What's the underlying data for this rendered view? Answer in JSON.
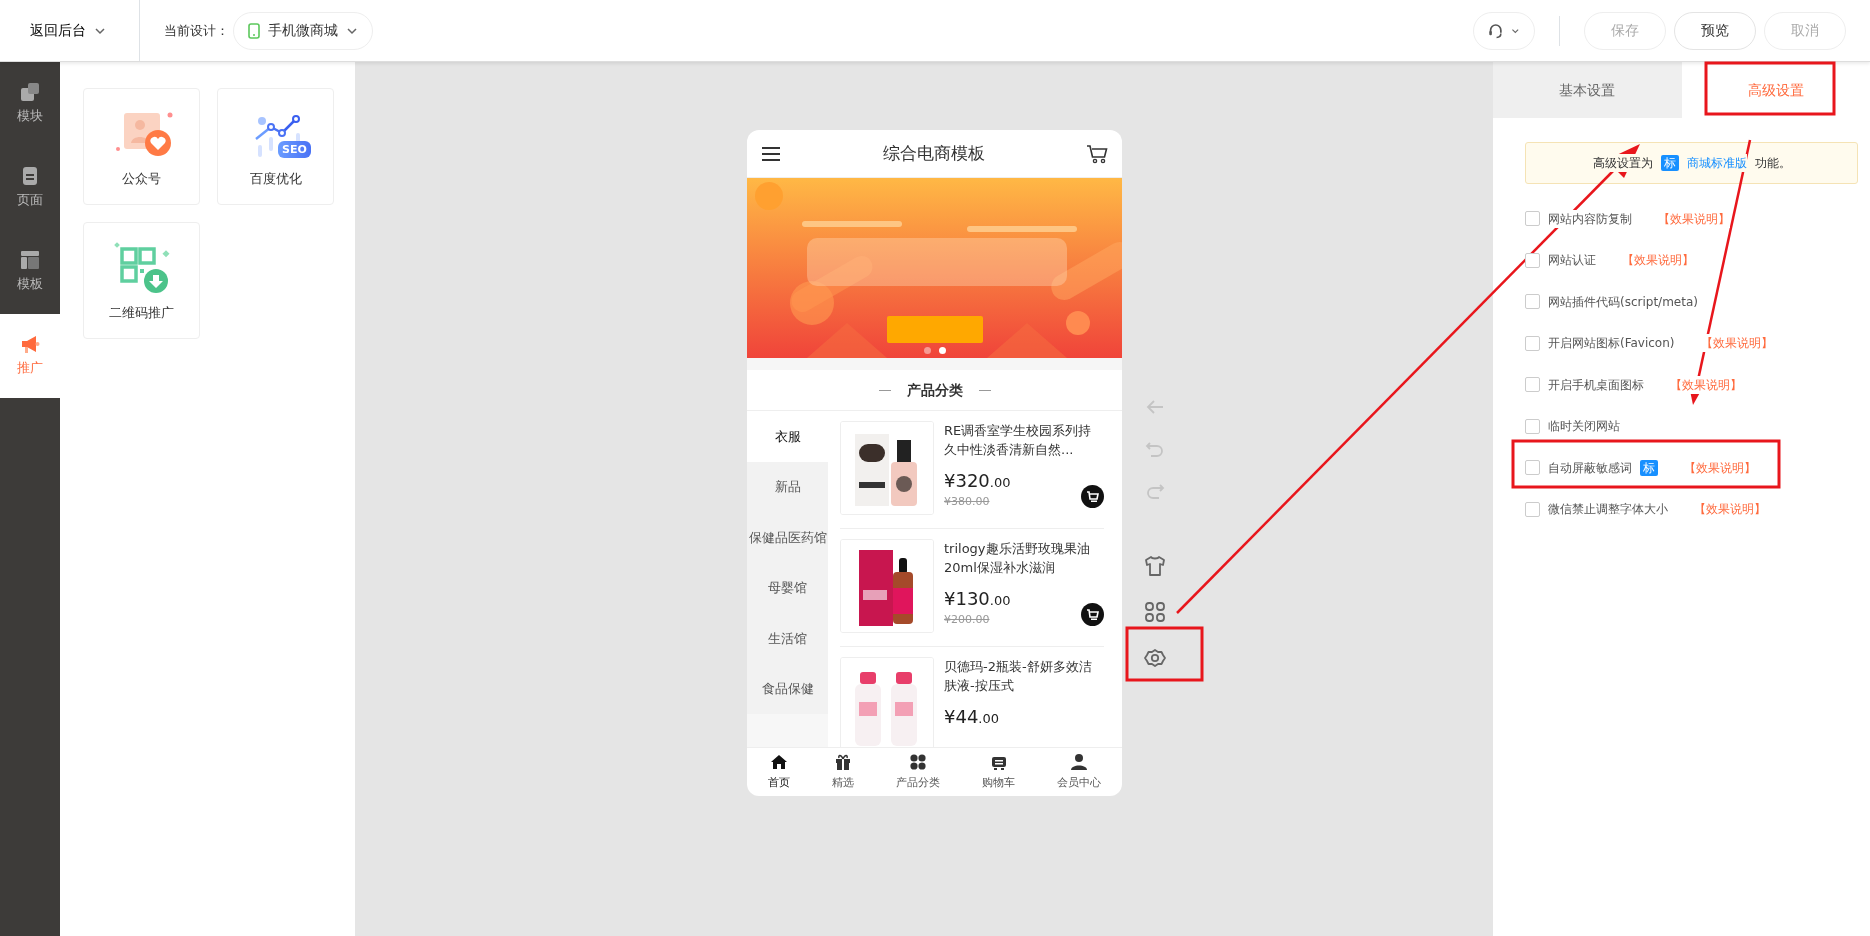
{
  "topbar": {
    "back": "返回后台",
    "design_label": "当前设计：",
    "design": "手机微商城",
    "buttons": [
      {
        "label": "保存",
        "disabled": true
      },
      {
        "label": "预览",
        "disabled": false
      },
      {
        "label": "取消",
        "disabled": true
      }
    ]
  },
  "sidebar": {
    "items": [
      {
        "kind": "module",
        "label": "模块",
        "selected": false
      },
      {
        "kind": "page",
        "label": "页面",
        "selected": false
      },
      {
        "kind": "template",
        "label": "模板",
        "selected": false
      },
      {
        "kind": "promote",
        "label": "推广",
        "selected": true
      }
    ]
  },
  "modules": [
    {
      "kind": "wechat",
      "label": "公众号"
    },
    {
      "kind": "seo",
      "label": "百度优化",
      "badge": "SEO"
    },
    {
      "kind": "qrcode",
      "label": "二维码推广"
    }
  ],
  "phone": {
    "title": "综合电商模板",
    "banner": {
      "kind": "picture",
      "dots": [
        {
          "selected": false
        },
        {
          "selected": true
        }
      ]
    },
    "section_title": "产品分类",
    "categories": [
      {
        "label": "衣服",
        "selected": true
      },
      {
        "label": "新品",
        "selected": false
      },
      {
        "label": "保健品医药馆",
        "selected": false
      },
      {
        "label": "母婴馆",
        "selected": false
      },
      {
        "label": "生活馆",
        "selected": false
      },
      {
        "label": "食品保健",
        "selected": false
      }
    ],
    "products": [
      {
        "kind": "perfume",
        "name": "RE调香室学生校园系列持久中性淡香清新自然...",
        "price": "¥320.00",
        "old_price": "¥380.00"
      },
      {
        "kind": "oil",
        "name": "trilogy趣乐活野玫瑰果油20ml保湿补水滋润",
        "price": "¥130.00",
        "old_price": "¥200.00"
      },
      {
        "kind": "cleanser",
        "name": "贝德玛-2瓶装-舒妍多效洁肤液-按压式",
        "price": "¥44.00"
      }
    ],
    "tabbar": [
      {
        "kind": "home",
        "label": "首页",
        "selected": true
      },
      {
        "kind": "gift",
        "label": "精选",
        "selected": false
      },
      {
        "kind": "category",
        "label": "产品分类",
        "selected": false
      },
      {
        "kind": "cart",
        "label": "购物车",
        "selected": false
      },
      {
        "kind": "user",
        "label": "会员中心",
        "selected": false
      }
    ]
  },
  "tools": [
    {
      "kind": "back",
      "disabled": true
    },
    {
      "kind": "undo",
      "disabled": true
    },
    {
      "kind": "redo",
      "disabled": true
    },
    {
      "kind": "shirt",
      "disabled": false
    },
    {
      "kind": "grid",
      "disabled": false
    },
    {
      "kind": "settings",
      "disabled": false
    }
  ],
  "settings": {
    "tabs": [
      {
        "label": "基本设置",
        "selected": false
      },
      {
        "label": "高级设置",
        "selected": true
      }
    ],
    "notice": {
      "before": "高级设置为",
      "badge": "标",
      "link": "商城标准版",
      "after": "功能。"
    },
    "options": [
      {
        "label": "网站内容防复制",
        "checked": false,
        "link": "【效果说明】"
      },
      {
        "label": "网站认证",
        "checked": false,
        "link": "【效果说明】"
      },
      {
        "label": "网站插件代码(script/meta)",
        "checked": false
      },
      {
        "label": "开启网站图标(Favicon)",
        "checked": false,
        "link": "【效果说明】"
      },
      {
        "label": "开启手机桌面图标",
        "checked": false,
        "link": "【效果说明】"
      },
      {
        "label": "临时关闭网站",
        "checked": false
      },
      {
        "label": "自动屏蔽敏感词",
        "checked": false,
        "badge": "标",
        "link": "【效果说明】"
      },
      {
        "label": "微信禁止调整字体大小",
        "checked": false,
        "link": "【效果说明】"
      }
    ]
  }
}
